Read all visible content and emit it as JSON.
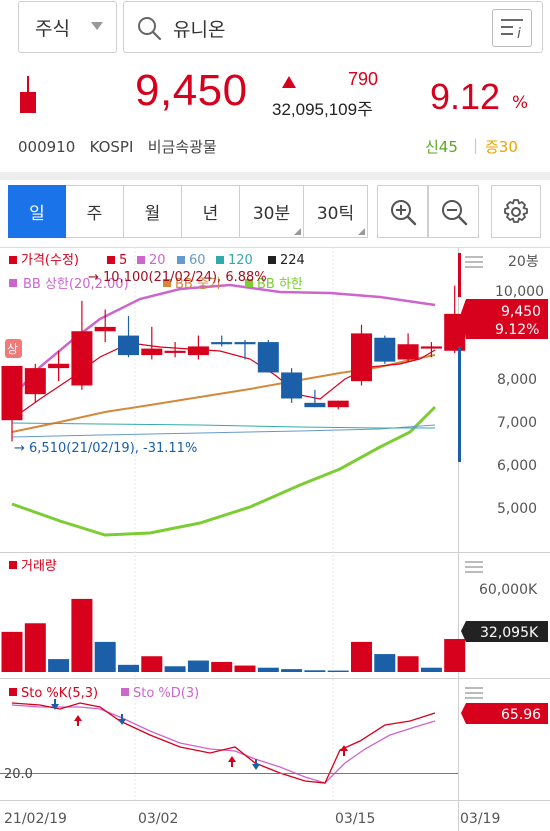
{
  "search": {
    "market": "주식",
    "query": "유니온"
  },
  "quote": {
    "price": "9,450",
    "change": "790",
    "volume": "32,095,109주",
    "rate": "9.12",
    "rate_unit": "%",
    "code": "000910",
    "market": "KOSPI",
    "sector": "비금속광물",
    "new_high": "신45",
    "margin": "증30",
    "up_color": "#d7001d"
  },
  "tabs": [
    {
      "label": "일",
      "active": true
    },
    {
      "label": "주",
      "active": false
    },
    {
      "label": "월",
      "active": false
    },
    {
      "label": "년",
      "active": false
    },
    {
      "label": "30분",
      "active": false
    },
    {
      "label": "30틱",
      "active": false
    }
  ],
  "tools": [
    "zoom-in-icon",
    "zoom-out-icon",
    "settings-gear-icon"
  ],
  "chart_data": {
    "type": "candlestick",
    "x_tick_labels": [
      "21/02/19",
      "03/02",
      "03/15",
      "03/19"
    ],
    "price_panel": {
      "legend": [
        "가격(수정)",
        "5",
        "20",
        "60",
        "120",
        "224"
      ],
      "legend_colors": [
        "#d7001d",
        "#d7001d",
        "#cc66cc",
        "#6699cc",
        "#33aaaa",
        "#222222"
      ],
      "legend2": [
        "BB 상한(20,2.00)",
        "BB 중기",
        "BB 하한"
      ],
      "y_ticks": [
        "20봉",
        "10,000",
        "9,450",
        "9.12%",
        "8,000",
        "7,000",
        "6,000",
        "5,000"
      ],
      "ylim": [
        4800,
        10500
      ],
      "max_annotation": "10,100(21/02/24), 6.88%",
      "min_annotation": "6,510(21/02/19), -31.11%",
      "current_price_label": "9,450",
      "current_rate_label": "9.12%",
      "limit_up_badge": "상",
      "candles": [
        {
          "o": 7000,
          "h": 8250,
          "l": 6510,
          "c": 8250
        },
        {
          "o": 7600,
          "h": 8300,
          "l": 7400,
          "c": 8200
        },
        {
          "o": 8200,
          "h": 8600,
          "l": 7900,
          "c": 8300
        },
        {
          "o": 7800,
          "h": 9750,
          "l": 7700,
          "c": 9050
        },
        {
          "o": 9050,
          "h": 9550,
          "l": 8800,
          "c": 9150
        },
        {
          "o": 8950,
          "h": 9400,
          "l": 8450,
          "c": 8500
        },
        {
          "o": 8500,
          "h": 9150,
          "l": 8400,
          "c": 8650
        },
        {
          "o": 8550,
          "h": 8800,
          "l": 8450,
          "c": 8600
        },
        {
          "o": 8500,
          "h": 8950,
          "l": 8400,
          "c": 8700
        },
        {
          "o": 8800,
          "h": 8950,
          "l": 8700,
          "c": 8750
        },
        {
          "o": 8800,
          "h": 8850,
          "l": 8400,
          "c": 8750
        },
        {
          "o": 8800,
          "h": 8850,
          "l": 8100,
          "c": 8100
        },
        {
          "o": 8100,
          "h": 8200,
          "l": 7400,
          "c": 7500
        },
        {
          "o": 7400,
          "h": 7700,
          "l": 7300,
          "c": 7300
        },
        {
          "o": 7300,
          "h": 7450,
          "l": 7250,
          "c": 7450
        },
        {
          "o": 7900,
          "h": 9200,
          "l": 7800,
          "c": 9000
        },
        {
          "o": 8900,
          "h": 8950,
          "l": 8300,
          "c": 8350
        },
        {
          "o": 8400,
          "h": 9000,
          "l": 8350,
          "c": 8750
        },
        {
          "o": 8650,
          "h": 8800,
          "l": 8450,
          "c": 8700
        },
        {
          "o": 8600,
          "h": 10100,
          "l": 8550,
          "c": 9450
        }
      ]
    },
    "volume_panel": {
      "legend": "거래량",
      "y_ticks": [
        "60,000K"
      ],
      "current_label": "32,095K",
      "ylim": [
        0,
        65000
      ],
      "values": [
        {
          "v": 28000,
          "up": true
        },
        {
          "v": 34000,
          "up": true
        },
        {
          "v": 9000,
          "up": false
        },
        {
          "v": 51000,
          "up": true
        },
        {
          "v": 21000,
          "up": false
        },
        {
          "v": 5000,
          "up": false
        },
        {
          "v": 11000,
          "up": true
        },
        {
          "v": 4000,
          "up": false
        },
        {
          "v": 8000,
          "up": false
        },
        {
          "v": 7000,
          "up": true
        },
        {
          "v": 4500,
          "up": true
        },
        {
          "v": 3000,
          "up": false
        },
        {
          "v": 2000,
          "up": false
        },
        {
          "v": 1200,
          "up": false
        },
        {
          "v": 1000,
          "up": false
        },
        {
          "v": 21000,
          "up": true
        },
        {
          "v": 12500,
          "up": false
        },
        {
          "v": 11000,
          "up": true
        },
        {
          "v": 3000,
          "up": false
        },
        {
          "v": 23000,
          "up": true
        }
      ]
    },
    "sto_panel": {
      "legend": [
        "Sto %K(5,3)",
        "Sto %D(3)"
      ],
      "legend_colors": [
        "#d7001d",
        "#cc66cc"
      ],
      "level_label": "20.0",
      "current_label": "65.96",
      "ylim": [
        0,
        100
      ]
    }
  }
}
